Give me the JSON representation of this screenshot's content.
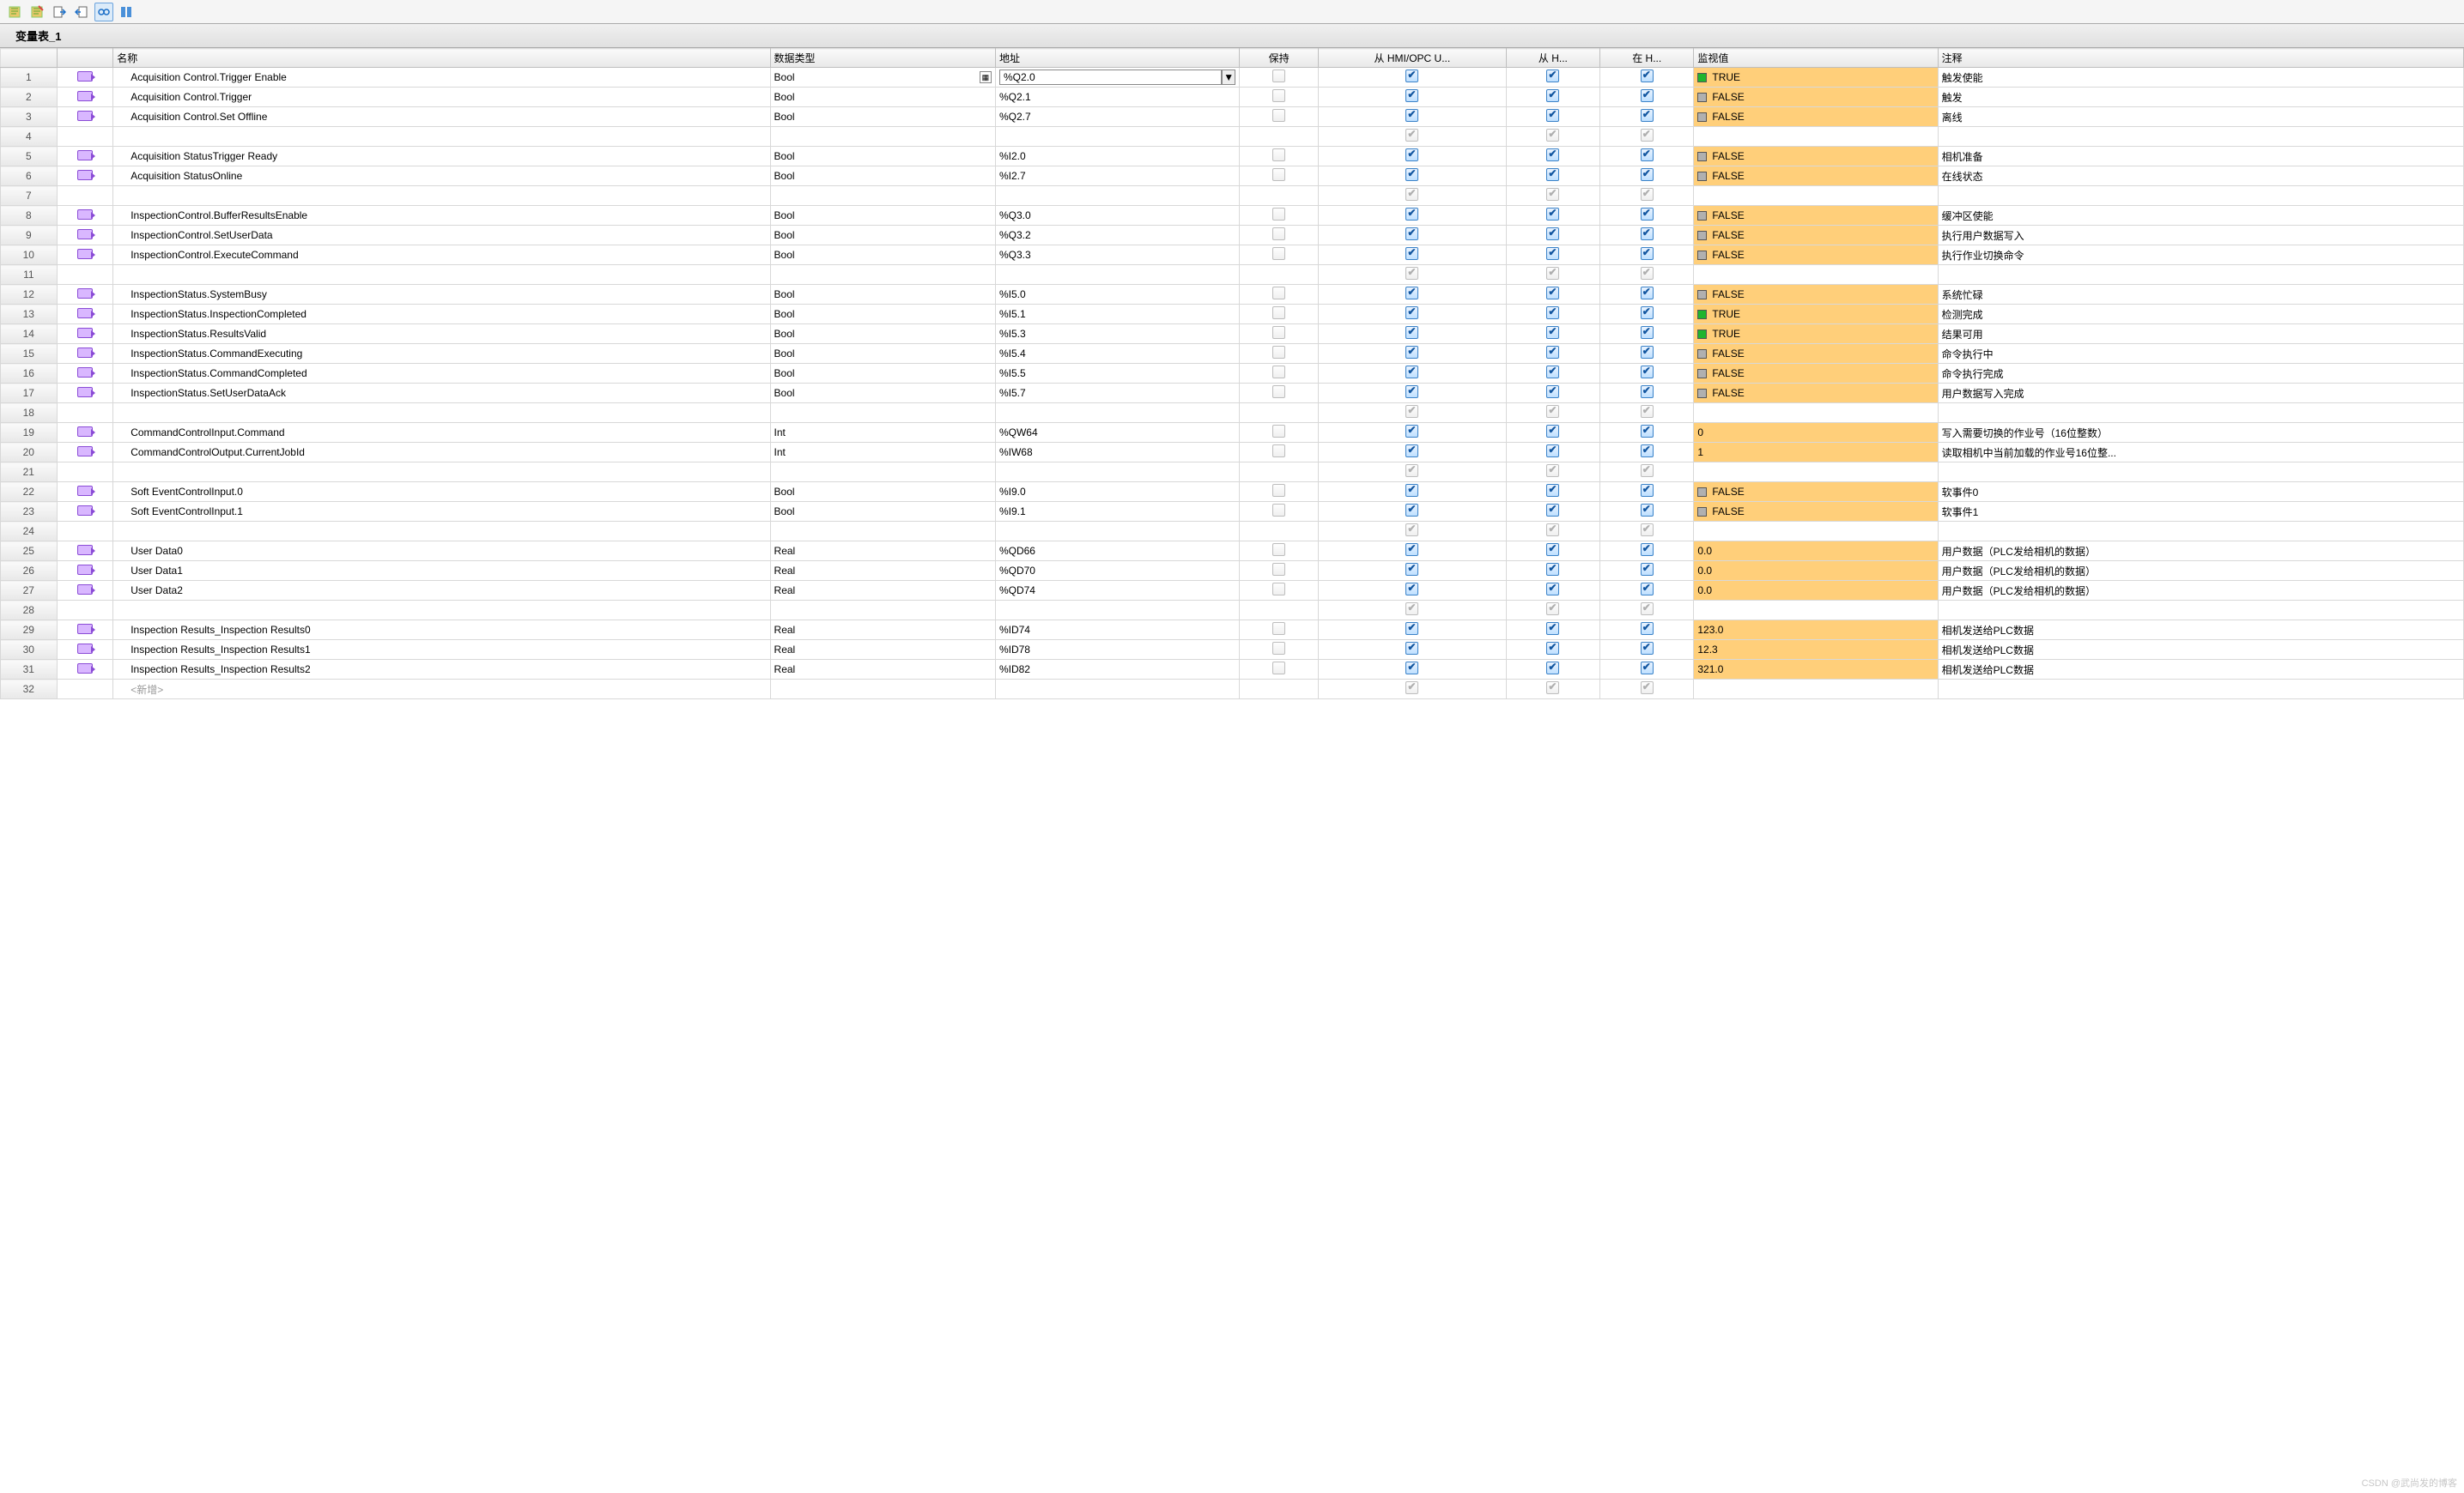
{
  "title": "变量表_1",
  "watermark": "CSDN @武尚发的博客",
  "header": {
    "rownum": "",
    "tag": "",
    "name": "名称",
    "type": "数据类型",
    "addr": "地址",
    "keep": "保持",
    "hmi1": "从 HMI/OPC U...",
    "hmi2": "从 H...",
    "hmi3": "在 H...",
    "mon": "监视值",
    "com": "注释"
  },
  "addr_editing": "%Q2.0",
  "new_placeholder": "<新增>",
  "rows": [
    {
      "n": "1",
      "tag": true,
      "name": "Acquisition Control.Trigger Enable",
      "type": "Bool",
      "addr": "%Q2.0",
      "addrEdit": true,
      "keep": false,
      "c1": "blue",
      "c2": "blue",
      "c3": "blue",
      "mon": {
        "led": "green",
        "v": "TRUE"
      },
      "com": "触发使能"
    },
    {
      "n": "2",
      "tag": true,
      "name": "Acquisition Control.Trigger",
      "type": "Bool",
      "addr": "%Q2.1",
      "keep": false,
      "c1": "blue",
      "c2": "blue",
      "c3": "blue",
      "mon": {
        "led": "grey",
        "v": "FALSE"
      },
      "com": "触发"
    },
    {
      "n": "3",
      "tag": true,
      "name": "Acquisition Control.Set Offline",
      "type": "Bool",
      "addr": "%Q2.7",
      "keep": false,
      "c1": "blue",
      "c2": "blue",
      "c3": "blue",
      "mon": {
        "led": "grey",
        "v": "FALSE"
      },
      "com": "离线"
    },
    {
      "n": "4",
      "tag": false,
      "name": "",
      "type": "",
      "addr": "",
      "keep": null,
      "c1": "grey",
      "c2": "grey",
      "c3": "grey",
      "mon": null,
      "com": ""
    },
    {
      "n": "5",
      "tag": true,
      "name": "Acquisition StatusTrigger Ready",
      "type": "Bool",
      "addr": "%I2.0",
      "keep": false,
      "c1": "blue",
      "c2": "blue",
      "c3": "blue",
      "mon": {
        "led": "grey",
        "v": "FALSE"
      },
      "com": "相机准备"
    },
    {
      "n": "6",
      "tag": true,
      "name": "Acquisition StatusOnline",
      "type": "Bool",
      "addr": "%I2.7",
      "keep": false,
      "c1": "blue",
      "c2": "blue",
      "c3": "blue",
      "mon": {
        "led": "grey",
        "v": "FALSE"
      },
      "com": "在线状态"
    },
    {
      "n": "7",
      "tag": false,
      "name": "",
      "type": "",
      "addr": "",
      "keep": null,
      "c1": "grey",
      "c2": "grey",
      "c3": "grey",
      "mon": null,
      "com": ""
    },
    {
      "n": "8",
      "tag": true,
      "name": "InspectionControl.BufferResultsEnable",
      "type": "Bool",
      "addr": "%Q3.0",
      "keep": false,
      "c1": "blue",
      "c2": "blue",
      "c3": "blue",
      "mon": {
        "led": "grey",
        "v": "FALSE"
      },
      "com": "缓冲区使能"
    },
    {
      "n": "9",
      "tag": true,
      "name": "InspectionControl.SetUserData",
      "type": "Bool",
      "addr": "%Q3.2",
      "keep": false,
      "c1": "blue",
      "c2": "blue",
      "c3": "blue",
      "mon": {
        "led": "grey",
        "v": "FALSE"
      },
      "com": "执行用户数据写入"
    },
    {
      "n": "10",
      "tag": true,
      "name": "InspectionControl.ExecuteCommand",
      "type": "Bool",
      "addr": "%Q3.3",
      "keep": false,
      "c1": "blue",
      "c2": "blue",
      "c3": "blue",
      "mon": {
        "led": "grey",
        "v": "FALSE"
      },
      "com": "执行作业切换命令"
    },
    {
      "n": "11",
      "tag": false,
      "name": "",
      "type": "",
      "addr": "",
      "keep": null,
      "c1": "grey",
      "c2": "grey",
      "c3": "grey",
      "mon": null,
      "com": ""
    },
    {
      "n": "12",
      "tag": true,
      "name": "InspectionStatus.SystemBusy",
      "type": "Bool",
      "addr": "%I5.0",
      "keep": false,
      "c1": "blue",
      "c2": "blue",
      "c3": "blue",
      "mon": {
        "led": "grey",
        "v": "FALSE"
      },
      "com": "系统忙碌"
    },
    {
      "n": "13",
      "tag": true,
      "name": "InspectionStatus.InspectionCompleted",
      "type": "Bool",
      "addr": "%I5.1",
      "keep": false,
      "c1": "blue",
      "c2": "blue",
      "c3": "blue",
      "mon": {
        "led": "green",
        "v": "TRUE"
      },
      "com": "检测完成"
    },
    {
      "n": "14",
      "tag": true,
      "name": "InspectionStatus.ResultsValid",
      "type": "Bool",
      "addr": "%I5.3",
      "keep": false,
      "c1": "blue",
      "c2": "blue",
      "c3": "blue",
      "mon": {
        "led": "green",
        "v": "TRUE"
      },
      "com": "结果可用"
    },
    {
      "n": "15",
      "tag": true,
      "name": "InspectionStatus.CommandExecuting",
      "type": "Bool",
      "addr": "%I5.4",
      "keep": false,
      "c1": "blue",
      "c2": "blue",
      "c3": "blue",
      "mon": {
        "led": "grey",
        "v": "FALSE"
      },
      "com": "命令执行中"
    },
    {
      "n": "16",
      "tag": true,
      "name": "InspectionStatus.CommandCompleted",
      "type": "Bool",
      "addr": "%I5.5",
      "keep": false,
      "c1": "blue",
      "c2": "blue",
      "c3": "blue",
      "mon": {
        "led": "grey",
        "v": "FALSE"
      },
      "com": "命令执行完成"
    },
    {
      "n": "17",
      "tag": true,
      "name": "InspectionStatus.SetUserDataAck",
      "type": "Bool",
      "addr": "%I5.7",
      "keep": false,
      "c1": "blue",
      "c2": "blue",
      "c3": "blue",
      "mon": {
        "led": "grey",
        "v": "FALSE"
      },
      "com": "用户数据写入完成"
    },
    {
      "n": "18",
      "tag": false,
      "name": "",
      "type": "",
      "addr": "",
      "keep": null,
      "c1": "grey",
      "c2": "grey",
      "c3": "grey",
      "mon": null,
      "com": ""
    },
    {
      "n": "19",
      "tag": true,
      "name": "CommandControlInput.Command",
      "type": "Int",
      "addr": "%QW64",
      "keep": false,
      "c1": "blue",
      "c2": "blue",
      "c3": "blue",
      "mon": {
        "v": "0"
      },
      "com": "写入需要切换的作业号（16位整数）"
    },
    {
      "n": "20",
      "tag": true,
      "name": "CommandControlOutput.CurrentJobId",
      "type": "Int",
      "addr": "%IW68",
      "keep": false,
      "c1": "blue",
      "c2": "blue",
      "c3": "blue",
      "mon": {
        "v": "1"
      },
      "com": "读取相机中当前加载的作业号16位整..."
    },
    {
      "n": "21",
      "tag": false,
      "name": "",
      "type": "",
      "addr": "",
      "keep": null,
      "c1": "grey",
      "c2": "grey",
      "c3": "grey",
      "mon": null,
      "com": ""
    },
    {
      "n": "22",
      "tag": true,
      "name": "Soft EventControlInput.0",
      "type": "Bool",
      "addr": "%I9.0",
      "keep": false,
      "c1": "blue",
      "c2": "blue",
      "c3": "blue",
      "mon": {
        "led": "grey",
        "v": "FALSE"
      },
      "com": "软事件0"
    },
    {
      "n": "23",
      "tag": true,
      "name": "Soft EventControlInput.1",
      "type": "Bool",
      "addr": "%I9.1",
      "keep": false,
      "c1": "blue",
      "c2": "blue",
      "c3": "blue",
      "mon": {
        "led": "grey",
        "v": "FALSE"
      },
      "com": "软事件1"
    },
    {
      "n": "24",
      "tag": false,
      "name": "",
      "type": "",
      "addr": "",
      "keep": null,
      "c1": "grey",
      "c2": "grey",
      "c3": "grey",
      "mon": null,
      "com": ""
    },
    {
      "n": "25",
      "tag": true,
      "name": "User Data0",
      "type": "Real",
      "addr": "%QD66",
      "keep": false,
      "c1": "blue",
      "c2": "blue",
      "c3": "blue",
      "mon": {
        "v": "0.0"
      },
      "com": "用户数据（PLC发给相机的数据）"
    },
    {
      "n": "26",
      "tag": true,
      "name": "User Data1",
      "type": "Real",
      "addr": "%QD70",
      "keep": false,
      "c1": "blue",
      "c2": "blue",
      "c3": "blue",
      "mon": {
        "v": "0.0"
      },
      "com": "用户数据（PLC发给相机的数据）"
    },
    {
      "n": "27",
      "tag": true,
      "name": "User Data2",
      "type": "Real",
      "addr": "%QD74",
      "keep": false,
      "c1": "blue",
      "c2": "blue",
      "c3": "blue",
      "mon": {
        "v": "0.0"
      },
      "com": "用户数据（PLC发给相机的数据）"
    },
    {
      "n": "28",
      "tag": false,
      "name": "",
      "type": "",
      "addr": "",
      "keep": null,
      "c1": "grey",
      "c2": "grey",
      "c3": "grey",
      "mon": null,
      "com": ""
    },
    {
      "n": "29",
      "tag": true,
      "name": "Inspection Results_Inspection Results0",
      "type": "Real",
      "addr": "%ID74",
      "keep": false,
      "c1": "blue",
      "c2": "blue",
      "c3": "blue",
      "mon": {
        "v": "123.0"
      },
      "com": "相机发送给PLC数据"
    },
    {
      "n": "30",
      "tag": true,
      "name": "Inspection Results_Inspection Results1",
      "type": "Real",
      "addr": "%ID78",
      "keep": false,
      "c1": "blue",
      "c2": "blue",
      "c3": "blue",
      "mon": {
        "v": "12.3"
      },
      "com": "相机发送给PLC数据"
    },
    {
      "n": "31",
      "tag": true,
      "name": "Inspection Results_Inspection Results2",
      "type": "Real",
      "addr": "%ID82",
      "keep": false,
      "c1": "blue",
      "c2": "blue",
      "c3": "blue",
      "mon": {
        "v": "321.0"
      },
      "com": "相机发送给PLC数据"
    }
  ]
}
